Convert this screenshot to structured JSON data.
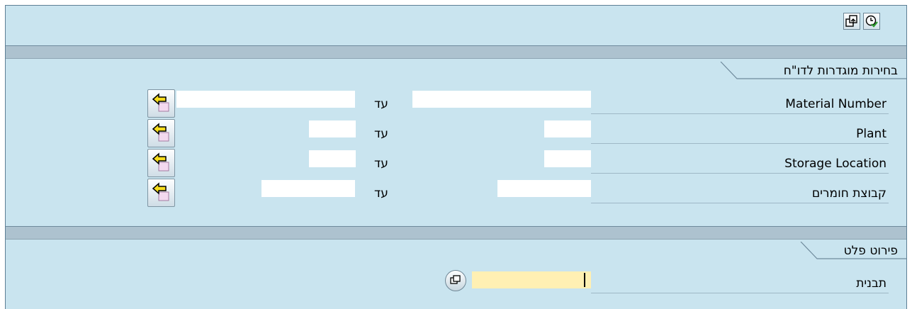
{
  "toolbar": {
    "buttons": [
      {
        "icon": "copy-variant-icon"
      },
      {
        "icon": "execute-clock-icon"
      }
    ]
  },
  "section_selections": {
    "title": "בחירות מוגדרות לדו\"ח",
    "rows": [
      {
        "label": "Material Number",
        "from_value": "",
        "to_label": "עד",
        "to_value": ""
      },
      {
        "label": "Plant",
        "from_value": "",
        "to_label": "עד",
        "to_value": ""
      },
      {
        "label": "Storage Location",
        "from_value": "",
        "to_label": "עד",
        "to_value": ""
      },
      {
        "label": "קבוצת חומרים",
        "from_value": "",
        "to_label": "עד",
        "to_value": ""
      }
    ]
  },
  "section_layout": {
    "title": "פירוט פלט",
    "field": {
      "label": "תבנית",
      "value": ""
    }
  },
  "colors": {
    "background": "#c9e4ef",
    "band": "#adc2cf",
    "required_field": "#fff0b3",
    "arrow_icon": "#f5dc1d"
  }
}
